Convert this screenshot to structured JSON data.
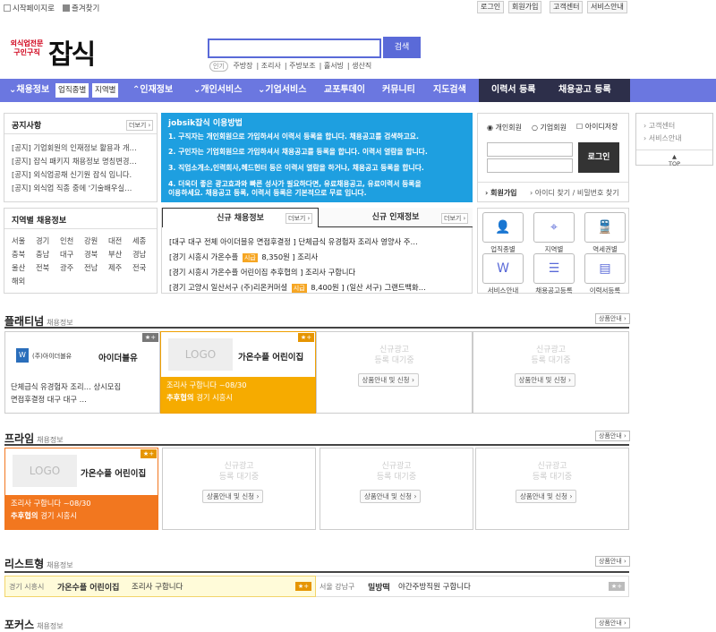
{
  "top": {
    "start_page": "시작페이지로",
    "bookmark": "즐겨찾기",
    "login": "로그인",
    "signup": "회원가입",
    "support": "고객센터",
    "service": "서비스안내"
  },
  "logo": {
    "sub": "외식업전문 구인구직",
    "main": "잡식"
  },
  "search": {
    "button": "검색",
    "placeholder": "",
    "popular_tag": "인기",
    "keywords": [
      "주방장",
      "조리사",
      "주방보조",
      "홀서빙",
      "생산직"
    ]
  },
  "nav": {
    "items": [
      "채용정보",
      "인재정보",
      "개인서비스",
      "기업서비스",
      "교포투데이",
      "커뮤니티",
      "지도검색"
    ],
    "sub1": "업직종별",
    "sub2": "지역별",
    "resume": "이력서 등록",
    "job_post": "채용공고 등록"
  },
  "notice": {
    "title": "공지사항",
    "more": "더보기 ›",
    "items": [
      "[공지] 기업회원의 인재정보 활용과 개…",
      "[공지] 잡식 패키지 채용정보 명칭변경…",
      "[공지] 외식업공채 신기원 잡식 입니다.",
      "[공지] 외식업 직종 중에 '기술배우실…"
    ]
  },
  "guide": {
    "title": "jobsik잡식 이용방법",
    "lines": [
      "1. 구직자는 개인회원으로 가입하셔서 이력서 등록을 합니다. 채용공고를 검색하고요.",
      "2. 구인자는 기업회원으로 가입하셔서 채용공고를 등록을 합니다. 이력서 열람을 합니다.",
      "3. 직업소개소,인력회사,헤드헌터 등은 이력서 열람을 하거나, 채용공고 등록을 합니다.",
      "4. 더욱더 좋은 광고효과와 빠른 성사가 필요하다면, 유료채용공고, 유료이력서 등록을",
      "이용하세요. 채용공고 등록, 이력서 등록은 기본적으로 무료 입니다."
    ]
  },
  "login": {
    "personal": "개인회원",
    "company": "기업회원",
    "save_id": "아이디저장",
    "button": "로그인",
    "join": "회원가입",
    "find": "아이디 찾기 / 비밀번호 찾기"
  },
  "side": {
    "support": "고객센터",
    "service": "서비스안내",
    "top": "TOP"
  },
  "region": {
    "title": "지역별 채용정보",
    "rows": [
      [
        "서울",
        "경기",
        "인천",
        "강원",
        "대전",
        "세종"
      ],
      [
        "충북",
        "충남",
        "대구",
        "경북",
        "부산",
        "경남"
      ],
      [
        "울산",
        "전북",
        "광주",
        "전남",
        "제주",
        "전국"
      ],
      [
        "해외"
      ]
    ]
  },
  "tabs": {
    "jobs": "신규 채용정보",
    "talent": "신규 인재정보",
    "more": "더보기 ›",
    "lines": [
      {
        "pre": "[대구 대구 전체  아이더블유  면접후결정 ] 단체급식 유경험자 조리사 영양사 주…",
        "badge": ""
      },
      {
        "pre": "[경기 시흥시  가온수플 ",
        "badge": "시급",
        "post": " 8,350원 ] 조리사"
      },
      {
        "pre": "[경기 시흥시  가온수플 어린이집  추후협의 ] 조리사 구합니다",
        "badge": ""
      },
      {
        "pre": "[경기 고양시 일산서구  (주)리온커머셜 ",
        "badge": "시급",
        "post": " 8,400원 ] (일산 서구) 그랜드백화…"
      }
    ]
  },
  "icons": [
    {
      "label": "업직종별",
      "icon": "person-icon"
    },
    {
      "label": "지역별",
      "icon": "map-icon"
    },
    {
      "label": "역세권별",
      "icon": "train-icon"
    },
    {
      "label": "서비스안내",
      "icon": "monitor-icon"
    },
    {
      "label": "채용공고등록",
      "icon": "document-icon"
    },
    {
      "label": "이력서등록",
      "icon": "resume-icon"
    }
  ],
  "platinum": {
    "title": "플래티넘",
    "sub": "채용정보",
    "goods": "상품안내 ›",
    "cards": [
      {
        "brand": "(주)아이더블유",
        "name": "아이더블유",
        "job": "단체급식 유경험자 조리… 상시모집",
        "cond": "면접후결정 대구 대구 …"
      },
      {
        "logo": "LOGO",
        "name": "가온수플 어린이집",
        "job": "조리사 구합니다 ~08/30",
        "cond_bold": "추후협의",
        "cond": "경기 시흥시"
      }
    ],
    "empty": {
      "line1": "신규광고",
      "line2": "등록 대기중",
      "btn": "상품안내 및 신청 ›"
    }
  },
  "prime": {
    "title": "프라임",
    "sub": "채용정보",
    "goods": "상품안내 ›",
    "card": {
      "logo": "LOGO",
      "name": "가온수플 어린이집",
      "job": "조리사 구합니다 ~08/30",
      "cond_bold": "추후협의",
      "cond": "경기 시흥시"
    },
    "empty": {
      "line1": "신규광고",
      "line2": "등록 대기중",
      "btn": "상품안내 및 신청 ›"
    }
  },
  "listtype": {
    "title": "리스트형",
    "sub": "채용정보",
    "goods": "상품안내 ›",
    "rows": [
      {
        "region": "경기 시흥시",
        "company": "가온수플 어린이집",
        "title": "조리사 구합니다"
      },
      {
        "region": "서울 강남구",
        "company": "밀방떡",
        "title": "야간주방직원 구합니다"
      }
    ]
  },
  "focus": {
    "title": "포커스",
    "sub": "채용정보",
    "goods": "상품안내 ›"
  },
  "colors": {
    "nav": "#6b77e0",
    "nav_dark": "#2d2f4a",
    "guide": "#1e9fe0",
    "highlight": "#f6ab00",
    "prime": "#f2771f"
  }
}
